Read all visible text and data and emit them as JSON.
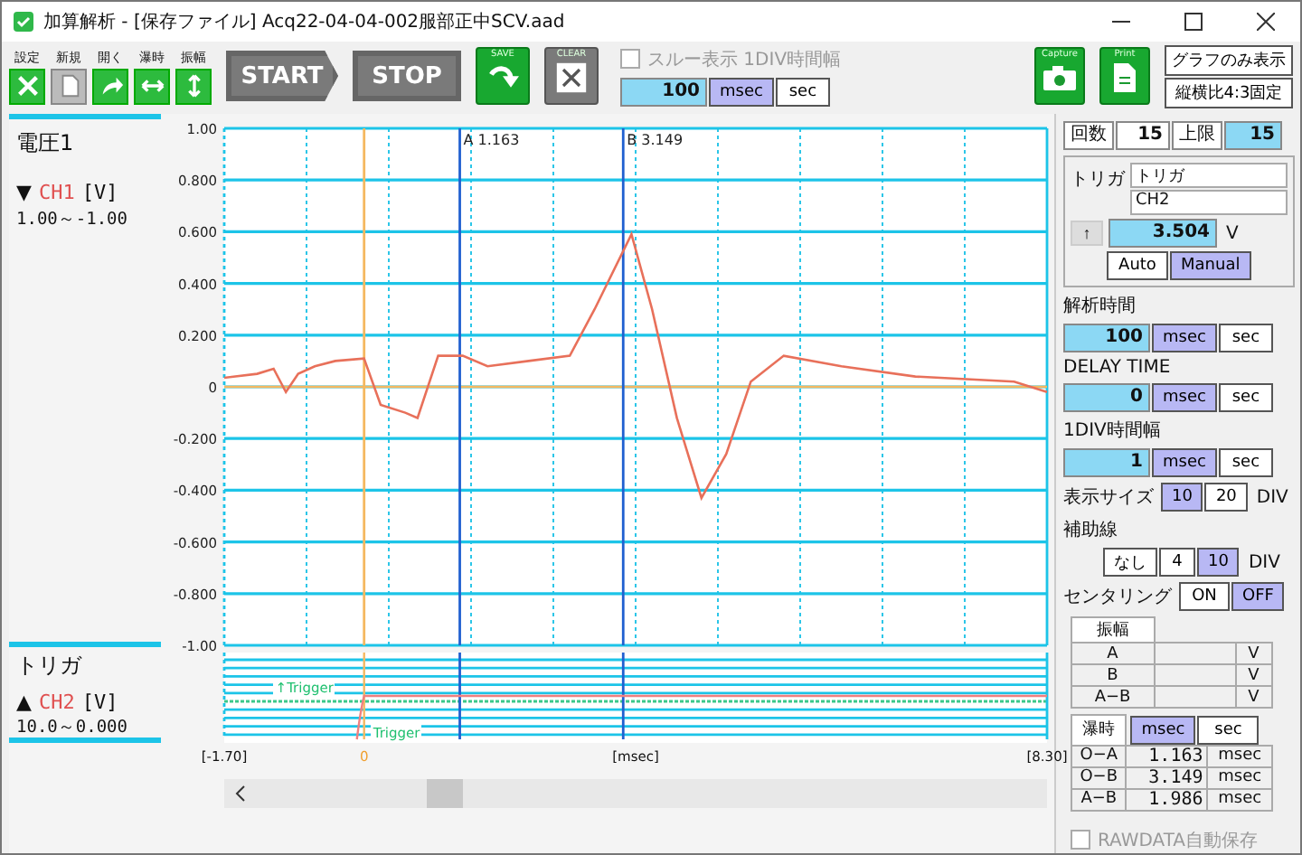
{
  "window": {
    "title": "加算解析 - [保存ファイル] Acq22-04-04-002服部正中SCV.aad"
  },
  "toolbar": {
    "tools": [
      {
        "label": "設定",
        "kind": "settings",
        "disabled": false
      },
      {
        "label": "新規",
        "kind": "new",
        "disabled": true
      },
      {
        "label": "開く",
        "kind": "open",
        "disabled": false
      },
      {
        "label": "瀑時",
        "kind": "time",
        "disabled": false
      },
      {
        "label": "振幅",
        "kind": "amplitude",
        "disabled": false
      }
    ],
    "start": "START",
    "stop": "STOP",
    "save": "SAVE",
    "clear": "CLEAR",
    "through_display": {
      "label": "スルー表示 1DIV時間幅",
      "checked": false,
      "value": "100",
      "units": [
        {
          "label": "msec",
          "selected": true
        },
        {
          "label": "sec",
          "selected": false
        }
      ]
    },
    "capture": "Capture",
    "print": "Print",
    "view_buttons": [
      "グラフのみ表示",
      "縦横比4:3固定"
    ]
  },
  "graph": {
    "channel_name": "電圧1",
    "channel": {
      "marker": "▼",
      "unit": "[V]",
      "range": "1.00～-1.00"
    },
    "trigger_name": "トリガ",
    "trigger_channel": {
      "marker": "▲",
      "name": "CH2",
      "unit": "[V]",
      "range": "10.0～0.000"
    },
    "cursors": [
      {
        "label": "A",
        "value": "1.163"
      },
      {
        "label": "B",
        "value": "3.149"
      }
    ],
    "trigger_labels": [
      "↑Trigger",
      "Trigger"
    ],
    "chart_data": {
      "type": "line",
      "xlabel": "[msec]",
      "grid": true,
      "ref_lines": [
        {
          "axis": "x",
          "value": 1.163,
          "color": "#2060d0"
        },
        {
          "axis": "x",
          "value": 3.149,
          "color": "#2060d0"
        },
        {
          "axis": "x",
          "value": 0,
          "color": "#f5b860"
        },
        {
          "axis": "y",
          "value": 0,
          "color": "#f5b860"
        },
        {
          "axis": "x",
          "value": -0.7,
          "color": "#2cc6e8"
        },
        {
          "axis": "x",
          "value": 0.3,
          "color": "#2cc6e8"
        },
        {
          "axis": "x",
          "value": 1.3,
          "color": "#2cc6e8"
        },
        {
          "axis": "x",
          "value": 2.3,
          "color": "#2cc6e8"
        },
        {
          "axis": "x",
          "value": 3.3,
          "color": "#2cc6e8"
        },
        {
          "axis": "x",
          "value": 4.3,
          "color": "#2cc6e8"
        },
        {
          "axis": "x",
          "value": 5.3,
          "color": "#2cc6e8"
        },
        {
          "axis": "x",
          "value": 6.3,
          "color": "#2cc6e8"
        },
        {
          "axis": "x",
          "value": 7.3,
          "color": "#2cc6e8"
        }
      ],
      "xlim": [
        -1.7,
        8.3
      ],
      "ylim": [
        -1,
        1
      ],
      "xticks": [
        {
          "value": -1.7,
          "label": "[-1.70]"
        },
        {
          "value": 0,
          "label": "0"
        },
        {
          "value": 8.3,
          "label": "[8.30]"
        }
      ],
      "yticks": [
        {
          "value": 1,
          "label": "1.00"
        },
        {
          "value": 0.8,
          "label": "0.800"
        },
        {
          "value": 0.6,
          "label": "0.600"
        },
        {
          "value": 0.4,
          "label": "0.400"
        },
        {
          "value": 0.2,
          "label": "0.200"
        },
        {
          "value": 0,
          "label": "0"
        },
        {
          "value": -0.2,
          "label": "-0.200"
        },
        {
          "value": -0.4,
          "label": "-0.400"
        },
        {
          "value": -0.6,
          "label": "-0.600"
        },
        {
          "value": -0.8,
          "label": "-0.800"
        },
        {
          "value": -1,
          "label": "-1.00"
        }
      ],
      "x": [
        -1.7,
        -1.3,
        -1.1,
        -0.95,
        -0.8,
        -0.6,
        -0.35,
        0,
        0.2,
        0.5,
        0.65,
        0.9,
        1.2,
        1.5,
        2.0,
        2.5,
        2.8,
        3.25,
        3.5,
        3.8,
        4.1,
        4.4,
        4.7,
        5.1,
        5.8,
        6.7,
        7.9,
        8.3
      ],
      "series": [
        {
          "name": "CH1",
          "color": "#e8705a",
          "values": [
            0.035,
            0.05,
            0.07,
            -0.02,
            0.05,
            0.08,
            0.1,
            0.11,
            -0.07,
            -0.1,
            -0.12,
            0.12,
            0.12,
            0.08,
            0.1,
            0.12,
            0.3,
            0.59,
            0.3,
            -0.12,
            -0.43,
            -0.26,
            0.02,
            0.12,
            0.08,
            0.04,
            0.02,
            -0.02
          ]
        }
      ]
    }
  },
  "panel": {
    "count_label": "回数",
    "count": "15",
    "limit_label": "上限",
    "limit": "15",
    "trigger": {
      "label": "トリガ",
      "source": "トリガ",
      "channel": "CH2",
      "edge": "↑",
      "level": "3.504",
      "unit": "V",
      "modes": [
        {
          "label": "Auto",
          "selected": false
        },
        {
          "label": "Manual",
          "selected": true
        }
      ]
    },
    "settings": [
      {
        "label": "解析時間",
        "value": "100",
        "units": [
          {
            "label": "msec",
            "selected": true
          },
          {
            "label": "sec",
            "selected": false
          }
        ]
      },
      {
        "label": "DELAY TIME",
        "value": "0",
        "units": [
          {
            "label": "msec",
            "selected": true
          },
          {
            "label": "sec",
            "selected": false
          }
        ]
      },
      {
        "label": "1DIV時間幅",
        "value": "1",
        "units": [
          {
            "label": "msec",
            "selected": true
          },
          {
            "label": "sec",
            "selected": false
          }
        ]
      }
    ],
    "display_size": {
      "label": "表示サイズ",
      "options": [
        {
          "label": "10",
          "selected": true
        },
        {
          "label": "20",
          "selected": false
        }
      ],
      "suffix": "DIV"
    },
    "aux_lines": {
      "label": "補助線",
      "options": [
        {
          "label": "なし",
          "selected": false
        },
        {
          "label": "4",
          "selected": false
        },
        {
          "label": "10",
          "selected": true
        }
      ],
      "suffix": "DIV"
    },
    "centering": {
      "label": "センタリング",
      "options": [
        {
          "label": "ON",
          "selected": false
        },
        {
          "label": "OFF",
          "selected": true
        }
      ]
    },
    "amplitude": {
      "header": "振幅",
      "rows": [
        {
          "name": "A",
          "unit": "V"
        },
        {
          "name": "B",
          "unit": "V"
        },
        {
          "name": "A−B",
          "unit": "V"
        }
      ]
    },
    "latency": {
      "header": "瀑時",
      "units": [
        {
          "label": "msec",
          "selected": true
        },
        {
          "label": "sec",
          "selected": false
        }
      ],
      "rows": [
        {
          "name": "O−A",
          "value": "1.163",
          "unit": "msec"
        },
        {
          "name": "O−B",
          "value": "3.149",
          "unit": "msec"
        },
        {
          "name": "A−B",
          "value": "1.986",
          "unit": "msec"
        }
      ]
    },
    "rawdata": {
      "label": "RAWDATA自動保存",
      "checked": false,
      "disabled": true
    }
  }
}
